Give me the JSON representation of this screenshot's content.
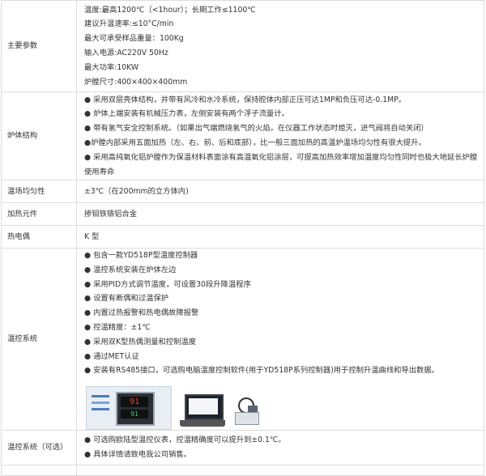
{
  "rows": [
    {
      "label": "主要参数",
      "lines": [
        "温度:最高1200℃（<1hour）；长期工作≤1100℃",
        "建议升温速率:≤10°C/min",
        "最大可承受样品重量：100Kg",
        "输入电源:AC220V 50Hz",
        "最大功率:10KW",
        "炉膛尺寸:400×400×400mm"
      ]
    },
    {
      "label": "炉体结构",
      "lines": [
        "● 采用双层壳体结构，并带有风冷和水冷系统，保持腔体内部正压可达1MP和负压可达-0.1MP。",
        "● 炉体上端安装有机械压力表，左侧安装有两个浮子流量计。",
        "● 带有氢气安全控制系统。（如果出气端燃烧氢气的火焰，在仪器工作状态时熄灭，进气阀将自动关闭）",
        "●炉膛内部采用五面加热（左、右、前、后和底部），比一般三面加热的高温炉温场均匀性有很大提升。",
        "● 采用高纯氧化铝炉膛作为保温材料表面涂有高温氧化铝涂层，可提高加热效率增加温度均匀性同时也极大地延长炉膛使用寿命"
      ]
    },
    {
      "label": "温场均匀性",
      "lines": [
        "±3℃（在200mm的立方体内)"
      ]
    },
    {
      "label": "加热元件",
      "lines": [
        "掺钼铁铬铝合金"
      ]
    },
    {
      "label": "热电偶",
      "lines": [
        "K 型"
      ]
    },
    {
      "label": "温控系统",
      "lines": [
        "● 包含一款YD518P型温度控制器",
        "● 温控系统安装在炉体左边",
        "● 采用PID方式调节温度，可设置30段升降温程序",
        "● 设置有断偶和过温保护",
        "● 内置过热报警和热电偶故障报警",
        "● 控温精度：±1℃",
        "● 采用双K型热偶测量和控制温度",
        "● 通过MET认证",
        "● 安装有RS485接口，可选购电脑温度控制软件(用于YD518P系列控制器)用于控制升温曲线和导出数据。"
      ],
      "controller_display": {
        "pv": "91",
        "sv": "91"
      }
    },
    {
      "label": "温控系统（可选）",
      "lines": [
        "● 可选购欧陆型温控仪表，控温精确度可以提升到±0.1℃。",
        "● 具体详情请致电我公司销售。"
      ]
    },
    {
      "label": "",
      "lines": []
    }
  ]
}
